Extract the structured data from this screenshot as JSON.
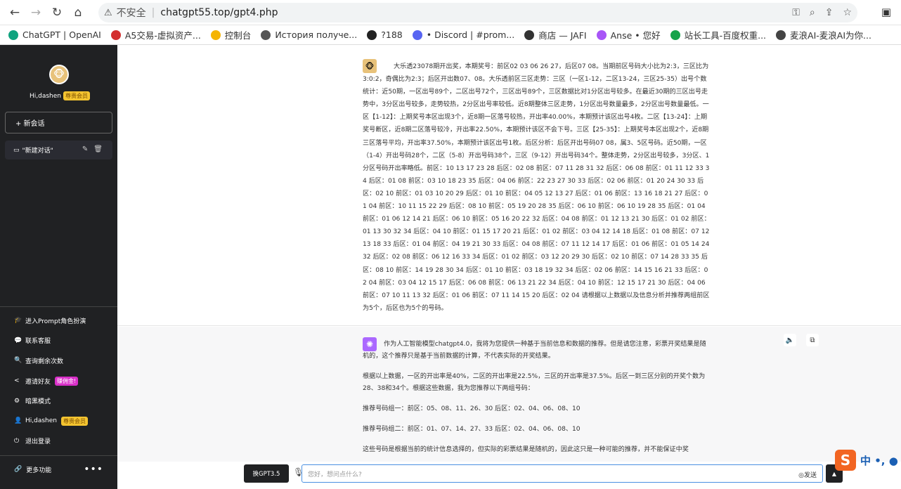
{
  "browser": {
    "insecure_label": "不安全",
    "url": "chatgpt55.top/gpt4.php",
    "bookmarks": [
      {
        "label": "ChatGPT | OpenAI",
        "color": "#10a37f"
      },
      {
        "label": "A5交易-虚拟资产...",
        "color": "#d32f2f"
      },
      {
        "label": "控制台",
        "color": "#f5b400"
      },
      {
        "label": "История получе...",
        "color": "#555555"
      },
      {
        "label": "?188",
        "color": "#222222"
      },
      {
        "label": "• Discord | #prom...",
        "color": "#5865f2"
      },
      {
        "label": "商店 — JAFI",
        "color": "#333333"
      },
      {
        "label": "Anse • 您好",
        "color": "#a855f7"
      },
      {
        "label": "站长工具-百度权重...",
        "color": "#16a34a"
      },
      {
        "label": "麦浪AI-麦浪AI为你...",
        "color": "#444444"
      }
    ]
  },
  "sidebar": {
    "user_name": "Hi,dashen",
    "vip_badge": "尊贵会员",
    "new_chat": "+ 新会话",
    "conversation": "\"新建对话\"",
    "menu": [
      {
        "icon": "graduation-icon",
        "glyph": "🎓",
        "label": "进入Prompt角色扮演"
      },
      {
        "icon": "chat-icon",
        "glyph": "💬",
        "label": "联系客服"
      },
      {
        "icon": "search-icon",
        "glyph": "🔍",
        "label": "查询剩余次数"
      },
      {
        "icon": "share-icon",
        "glyph": "<",
        "label": "邀请好友"
      },
      {
        "icon": "gear-icon",
        "glyph": "⚙",
        "label": "暗黑模式"
      },
      {
        "icon": "user-icon",
        "glyph": "👤",
        "label": "Hi,dashen"
      },
      {
        "icon": "power-icon",
        "glyph": "⏻",
        "label": "退出登录"
      }
    ],
    "invite_badge": "赚佣金!",
    "more": "更多功能"
  },
  "chat": {
    "question": "大乐透23078期开出奖，本期奖号：前区02 03 06 26 27，后区07 08。当期前区号码大小比为2:3，三区比为3:0:2，奇偶比为2:3；后区开出数07、08。大乐透前区三区走势：三区（一区1-12，二区13-24，三区25-35）出号个数统计：近50期，一区出号89个，二区出号72个，三区出号89个，三区数据比对1分区出号较多。在最近30期的三区出号走势中，3分区出号较多，走势较热，2分区出号率较低。近8期整体三区走势，1分区出号数量最多，2分区出号数量最低。一区【1-12】：上期奖号本区出现3个，近8期一区落号较热，开出率40.00%，本期预计该区出号4枚。二区【13-24】：上期奖号断区，近8期二区落号较冷，开出率22.50%，本期预计该区不会下号。三区【25-35】：上期奖号本区出现2个，近8期三区落号平均，开出率37.50%，本期预计该区出号1枚。后区分析：后区开出号码07 08，属3、5区号码。近50期，一区（1-4）开出号码28个，二区（5-8）开出号码38个，三区（9-12）开出号码34个。整体走势，2分区出号较多，3分区、1分区号码开出率略低。前区：10 13 17 23 28 后区：02 08 前区：07 11 28 31 32 后区：06 08 前区：01 11 12 33 34 后区：01 08 前区：03 10 18 23 35 后区：04 06 前区：22 23 27 30 33 后区：02 06 前区：01 20 24 30 33 后区：02 10 前区：01 03 10 20 29 后区：01 10 前区：04 05 12 13 27 后区：01 06 前区：13 16 18 21 27 后区：01 04 前区：10 11 15 22 29 后区：08 10 前区：05 19 20 28 35 后区：06 10 前区：06 10 19 28 35 后区：01 04 前区：01 06 12 14 21 后区：06 10 前区：05 16 20 22 32 后区：04 08 前区：01 12 13 21 30 后区：01 02 前区：01 13 30 32 34 后区：04 10 前区：01 15 17 20 21 后区：01 02 前区：03 04 12 14 18 后区：01 08 前区：07 12 13 18 33 后区：01 04 前区：04 19 21 30 33 后区：04 08 前区：07 11 12 14 17 后区：01 06 前区：01 05 14 24 32 后区：02 08 前区：06 12 16 33 34 后区：01 02 前区：03 12 20 29 30 后区：02 10 前区：07 14 28 33 35 后区：08 10 前区：14 19 28 30 34 后区：01 10 前区：03 18 19 32 34 后区：02 06 前区：14 15 16 21 33 后区：02 04 前区：03 04 12 15 17 后区：06 08 前区：06 13 21 22 34 后区：04 10 前区：12 15 17 21 30 后区：04 06 前区：07 10 11 13 32 后区：01 06 前区：07 11 14 15 20 后区：02 04 请根据以上数据以及信息分析并推荐两组前区为5个，后区也为5个的号码。",
    "answer": [
      "作为人工智能模型chatgpt4.0，我将为您提供一种基于当前信息和数据的推荐。但是请您注意，彩票开奖结果是随机的，这个推荐只是基于当前数据的计算，不代表实际的开奖结果。",
      "根据以上数据，一区的开出率是40%，二区的开出率是22.5%，三区的开出率是37.5%。后区一到三区分别的开奖个数为28、38和34个。根据这些数据，我为您推荐以下两组号码：",
      "推荐号码组一：前区：05、08、11、26、30 后区：02、04、06、08、10",
      "推荐号码组二：前区：01、07、14、27、33 后区：02、04、06、08、10",
      "这些号码是根据当前的统计信息选择的，但实际的彩票结果是随机的，因此这只是一种可能的推荐，并不能保证中奖"
    ]
  },
  "composer": {
    "model_button": "换GPT3.5",
    "placeholder": "您好，想问点什么?",
    "send": "发送"
  },
  "ime": {
    "logo": "S",
    "lang": "中 •, ●"
  }
}
